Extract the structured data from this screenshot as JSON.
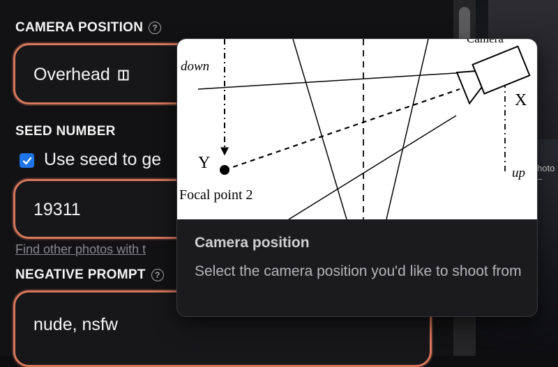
{
  "camera_position": {
    "label": "CAMERA POSITION",
    "value": "Overhead"
  },
  "seed_number": {
    "label": "SEED NUMBER",
    "checkbox_checked": true,
    "checkbox_label": "Use seed to ge",
    "value": "19311",
    "link": "Find other photos with t"
  },
  "negative_prompt": {
    "label": "NEGATIVE PROMPT",
    "value": "nude, nsfw"
  },
  "tooltip": {
    "title": "Camera position",
    "description": "Select the camera position you'd like to shoot from",
    "diagram": {
      "down": "down",
      "up": "up",
      "y": "Y",
      "x": "X",
      "focal_point": "Focal point 2",
      "camera": "Camera"
    }
  },
  "background": {
    "snippet_line1": "hoto",
    "snippet_line2": "–"
  },
  "colors": {
    "accent": "#d9785c",
    "checkbox": "#1f74e8"
  }
}
